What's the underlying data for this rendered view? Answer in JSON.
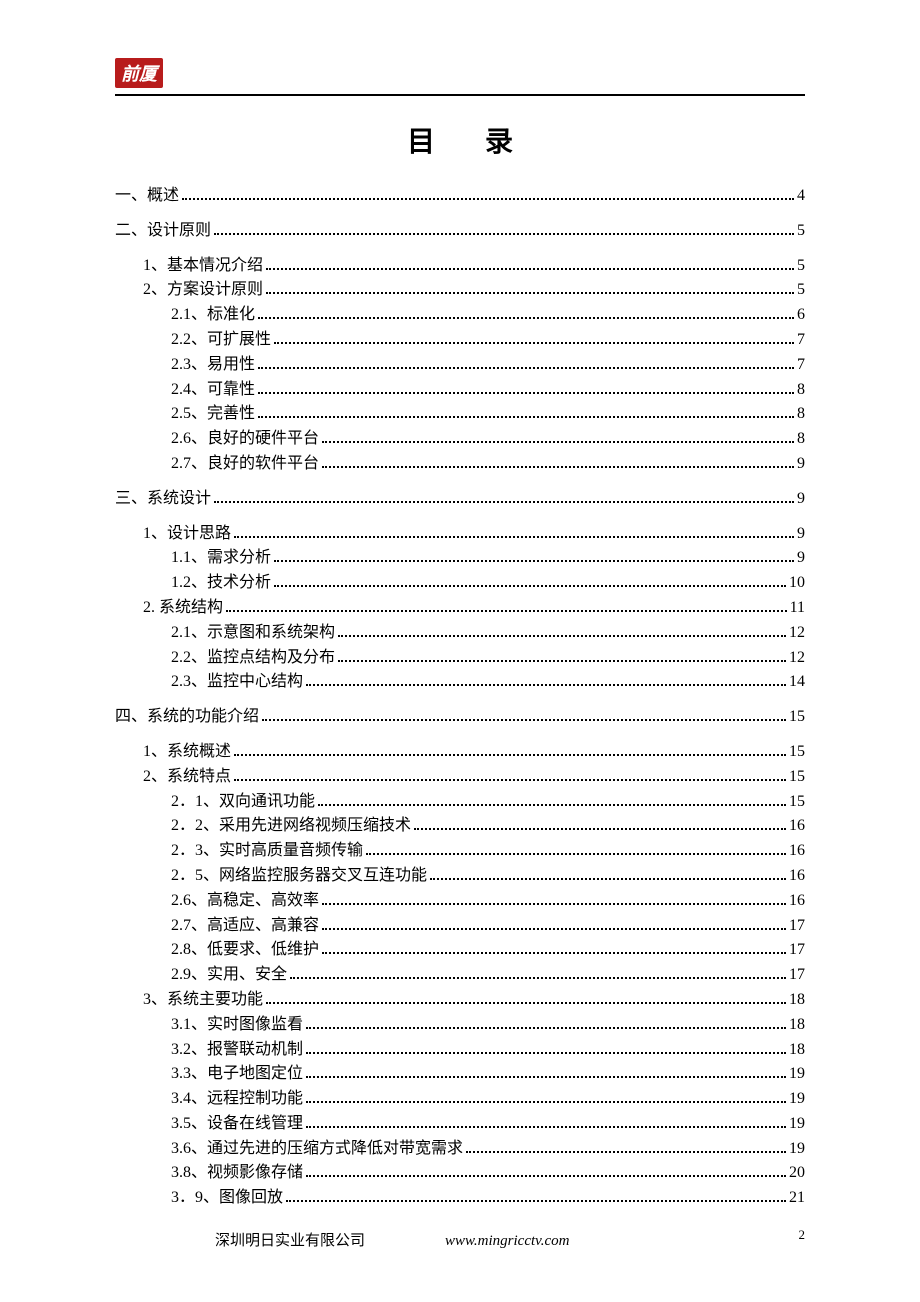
{
  "logo_text": "前厦",
  "title": "目录",
  "toc": [
    {
      "level": 1,
      "label": "一、概述",
      "page": "4",
      "section": true
    },
    {
      "level": 1,
      "label": "二、设计原则",
      "page": "5",
      "section": true
    },
    {
      "level": 2,
      "label": "1、基本情况介绍",
      "page": "5"
    },
    {
      "level": 2,
      "label": "2、方案设计原则",
      "page": "5"
    },
    {
      "level": 3,
      "label": "2.1、标准化",
      "page": "6"
    },
    {
      "level": 3,
      "label": "2.2、可扩展性",
      "page": "7"
    },
    {
      "level": 3,
      "label": "2.3、易用性",
      "page": "7"
    },
    {
      "level": 3,
      "label": "2.4、可靠性",
      "page": "8"
    },
    {
      "level": 3,
      "label": "2.5、完善性",
      "page": "8"
    },
    {
      "level": 3,
      "label": "2.6、良好的硬件平台",
      "page": "8"
    },
    {
      "level": 3,
      "label": "2.7、良好的软件平台",
      "page": "9"
    },
    {
      "level": 1,
      "label": "三、系统设计",
      "page": "9",
      "section": true
    },
    {
      "level": 2,
      "label": "1、设计思路",
      "page": "9"
    },
    {
      "level": 3,
      "label": "1.1、需求分析",
      "page": "9"
    },
    {
      "level": 3,
      "label": "1.2、技术分析",
      "page": "10"
    },
    {
      "level": 2,
      "label": "2. 系统结构",
      "page": "11"
    },
    {
      "level": 3,
      "label": "2.1、示意图和系统架构",
      "page": "12"
    },
    {
      "level": 3,
      "label": "2.2、监控点结构及分布",
      "page": "12"
    },
    {
      "level": 3,
      "label": "2.3、监控中心结构",
      "page": "14"
    },
    {
      "level": 1,
      "label": "四、系统的功能介绍",
      "page": "15",
      "section": true
    },
    {
      "level": 2,
      "label": "1、系统概述",
      "page": "15"
    },
    {
      "level": 2,
      "label": "2、系统特点",
      "page": "15"
    },
    {
      "level": 3,
      "label": "2．1、双向通讯功能",
      "page": "15"
    },
    {
      "level": 3,
      "label": "2．2、采用先进网络视频压缩技术",
      "page": "16"
    },
    {
      "level": 3,
      "label": "2．3、实时高质量音频传输",
      "page": "16"
    },
    {
      "level": 3,
      "label": "2．5、网络监控服务器交叉互连功能",
      "page": "16"
    },
    {
      "level": 3,
      "label": "2.6、高稳定、高效率",
      "page": "16"
    },
    {
      "level": 3,
      "label": "2.7、高适应、高兼容",
      "page": "17"
    },
    {
      "level": 3,
      "label": "2.8、低要求、低维护",
      "page": "17"
    },
    {
      "level": 3,
      "label": "2.9、实用、安全",
      "page": "17"
    },
    {
      "level": 2,
      "label": "3、系统主要功能",
      "page": "18"
    },
    {
      "level": 3,
      "label": "3.1、实时图像监看",
      "page": "18"
    },
    {
      "level": 3,
      "label": "3.2、报警联动机制",
      "page": "18"
    },
    {
      "level": 3,
      "label": "3.3、电子地图定位",
      "page": "19"
    },
    {
      "level": 3,
      "label": "3.4、远程控制功能",
      "page": "19"
    },
    {
      "level": 3,
      "label": "3.5、设备在线管理",
      "page": "19"
    },
    {
      "level": 3,
      "label": "3.6、通过先进的压缩方式降低对带宽需求",
      "page": "19"
    },
    {
      "level": 3,
      "label": "3.8、视频影像存储",
      "page": "20"
    },
    {
      "level": 3,
      "label": "3．9、图像回放",
      "page": "21"
    }
  ],
  "footer": {
    "company": "深圳明日实业有限公司",
    "url": "www.mingricctv.com",
    "page_number": "2"
  }
}
